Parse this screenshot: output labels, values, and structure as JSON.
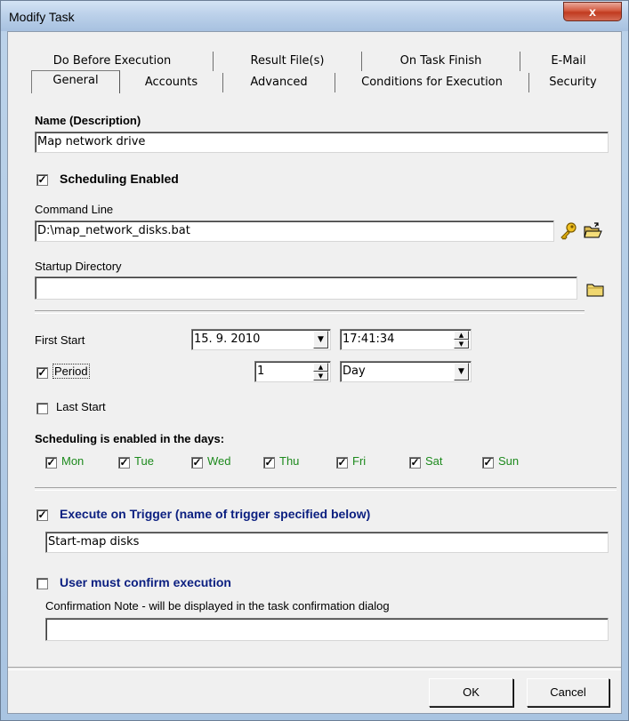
{
  "window": {
    "title": "Modify Task",
    "close_glyph": "x"
  },
  "tabs": {
    "row1": [
      "Do Before Execution",
      "Result File(s)",
      "On Task Finish",
      "E-Mail"
    ],
    "row2": [
      "General",
      "Accounts",
      "Advanced",
      "Conditions for Execution",
      "Security"
    ],
    "active": "General"
  },
  "general": {
    "name_label": "Name (Description)",
    "name_value": "Map network drive",
    "scheduling_enabled_label": "Scheduling Enabled",
    "scheduling_enabled_checked": true,
    "command_line_label": "Command Line",
    "command_line_value": "D:\\map_network_disks.bat",
    "startup_dir_label": "Startup Directory",
    "startup_dir_value": "",
    "first_start_label": "First Start",
    "first_start_date": "15.  9. 2010",
    "first_start_time": "17:41:34",
    "period_label": "Period",
    "period_checked": true,
    "period_value": "1",
    "period_unit": "Day",
    "last_start_label": "Last Start",
    "last_start_checked": false,
    "days_label": "Scheduling is enabled in the days:",
    "days": [
      {
        "label": "Mon",
        "checked": true
      },
      {
        "label": "Tue",
        "checked": true
      },
      {
        "label": "Wed",
        "checked": true
      },
      {
        "label": "Thu",
        "checked": true
      },
      {
        "label": "Fri",
        "checked": true
      },
      {
        "label": "Sat",
        "checked": true
      },
      {
        "label": "Sun",
        "checked": true
      }
    ],
    "trigger_label": "Execute on Trigger (name of trigger specified below)",
    "trigger_checked": true,
    "trigger_value": "Start-map disks",
    "confirm_label": "User must confirm execution",
    "confirm_checked": false,
    "confirm_note_label": "Confirmation Note - will be displayed in the task confirmation dialog",
    "confirm_note_value": ""
  },
  "buttons": {
    "ok": "OK",
    "cancel": "Cancel"
  },
  "check_glyph": "✓"
}
